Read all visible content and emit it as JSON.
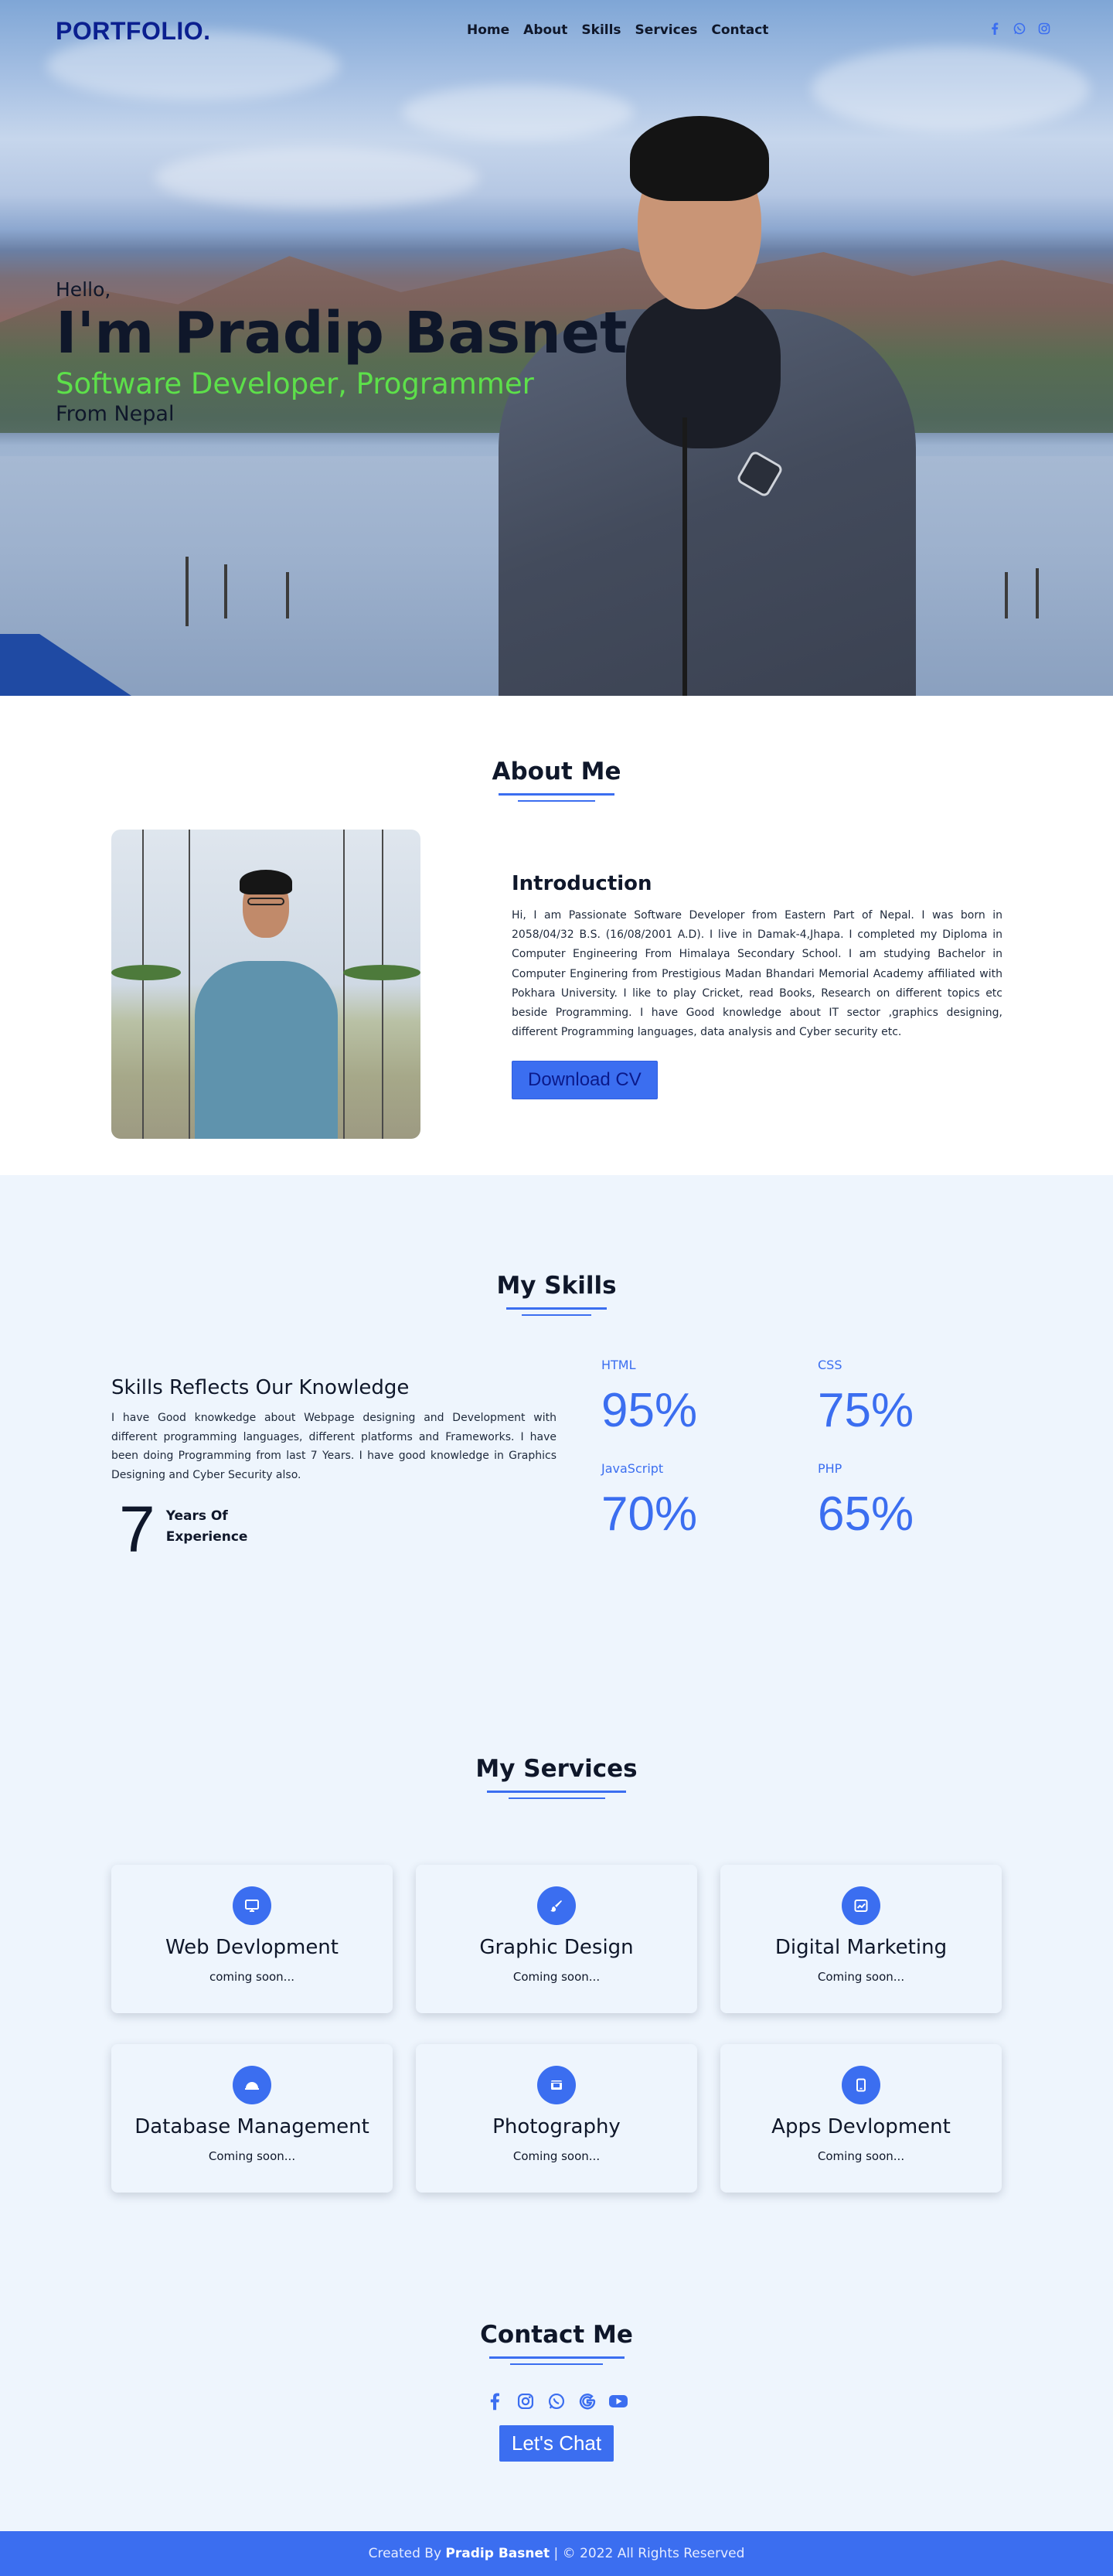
{
  "nav": {
    "logo": "PORTFOLIO.",
    "items": [
      {
        "label": "Home"
      },
      {
        "label": "About"
      },
      {
        "label": "Skills"
      },
      {
        "label": "Services"
      },
      {
        "label": "Contact"
      }
    ],
    "social_icons": [
      "facebook-icon",
      "whatsapp-icon",
      "instagram-icon"
    ]
  },
  "hero": {
    "greeting": "Hello,",
    "name": "I'm Pradip Basnet",
    "role": "Software Developer, Programmer",
    "location": "From Nepal"
  },
  "about": {
    "title": "About Me",
    "intro_heading": "Introduction",
    "intro_text": "Hi, I am Passionate Software Developer from Eastern Part of Nepal. I was born in 2058/04/32 B.S. (16/08/2001 A.D). I live in Damak-4,Jhapa. I completed my Diploma in Computer Engineering From Himalaya Secondary School. I am studying Bachelor in Computer Enginering from Prestigious Madan Bhandari Memorial Academy affiliated with Pokhara University. I like to play Cricket, read Books, Research on different topics etc beside Programming. I have Good knowledge about IT sector ,graphics designing, different Programming languages, data analysis and Cyber security etc.",
    "cv_button": "Download CV"
  },
  "skills": {
    "title": "My Skills",
    "heading": "Skills Reflects Our Knowledge",
    "text": "I have Good knowkedge about Webpage designing and Development with different programming languages, different platforms and Frameworks. I have been doing Programming from last 7 Years. I have good knowledge in Graphics Designing and Cyber Security also.",
    "years_number": "7",
    "years_label_1": "Years Of",
    "years_label_2": "Experience",
    "items": [
      {
        "name": "HTML",
        "value": "95%"
      },
      {
        "name": "CSS",
        "value": "75%"
      },
      {
        "name": "JavaScript",
        "value": "70%"
      },
      {
        "name": "PHP",
        "value": "65%"
      }
    ]
  },
  "services": {
    "title": "My Services",
    "items": [
      {
        "icon": "monitor-icon",
        "title": "Web Devlopment",
        "status": "coming soon..."
      },
      {
        "icon": "brush-icon",
        "title": "Graphic Design",
        "status": "Coming soon..."
      },
      {
        "icon": "chart-icon",
        "title": "Digital Marketing",
        "status": "Coming soon..."
      },
      {
        "icon": "database-icon",
        "title": "Database Management",
        "status": "Coming soon..."
      },
      {
        "icon": "camera-icon",
        "title": "Photography",
        "status": "Coming soon..."
      },
      {
        "icon": "mobile-icon",
        "title": "Apps Devlopment",
        "status": "Coming soon..."
      }
    ]
  },
  "contact": {
    "title": "Contact Me",
    "social_icons": [
      "facebook-icon",
      "instagram-icon",
      "whatsapp-icon",
      "google-icon",
      "youtube-icon"
    ],
    "chat_button": "Let's Chat"
  },
  "footer": {
    "prefix": "Created By",
    "author": "Pradip Basnet",
    "suffix": "| © 2022 All Rights Reserved"
  },
  "colors": {
    "accent": "#3b6ef0",
    "logo": "#0b1f8f",
    "role": "#5de04a",
    "section_bg": "#eef5fd"
  }
}
